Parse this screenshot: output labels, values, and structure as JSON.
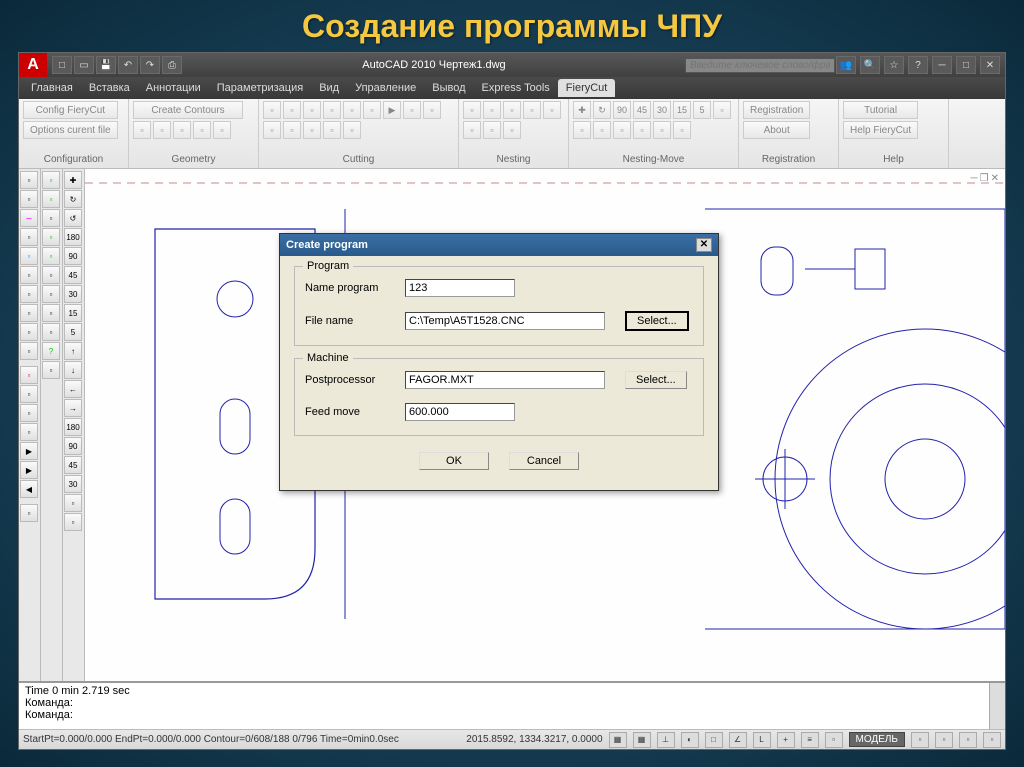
{
  "slide_title": "Создание программы ЧПУ",
  "qat": {
    "app_title": "AutoCAD 2010   Чертеж1.dwg",
    "search_placeholder": "Введите ключевое слово/фразу"
  },
  "menubar": {
    "items": [
      "Главная",
      "Вставка",
      "Аннотации",
      "Параметризация",
      "Вид",
      "Управление",
      "Вывод",
      "Express Tools",
      "FieryCut"
    ],
    "active": 8
  },
  "ribbon": {
    "groups": [
      {
        "label": "Configuration",
        "buttons": [
          "Config FieryCut",
          "Options curent file"
        ]
      },
      {
        "label": "Geometry",
        "buttons": [
          "Create Contours"
        ]
      },
      {
        "label": "Cutting"
      },
      {
        "label": "Nesting"
      },
      {
        "label": "Nesting-Move"
      },
      {
        "label": "Registration",
        "buttons": [
          "Registration",
          "About"
        ]
      },
      {
        "label": "Help",
        "buttons": [
          "Tutorial",
          "Help FieryCut"
        ]
      }
    ]
  },
  "dialog": {
    "title": "Create program",
    "program_group": "Program",
    "machine_group": "Machine",
    "name_label": "Name program",
    "name_value": "123",
    "file_label": "File name",
    "file_value": "C:\\Temp\\A5T1528.CNC",
    "select_btn": "Select...",
    "post_label": "Postprocessor",
    "post_value": "FAGOR.MXT",
    "feed_label": "Feed move",
    "feed_value": "600.000",
    "ok": "OK",
    "cancel": "Cancel"
  },
  "cmdline": {
    "line1": "Time  0 min 2.719 sec",
    "line2": "Команда:",
    "line3": "Команда:"
  },
  "statusbar": {
    "left": "StartPt=0.000/0.000  EndPt=0.000/0.000  Contour=0/608/188  0/796  Time=0min0.0sec",
    "coords": "2015.8592, 1334.3217, 0.0000",
    "model": "МОДЕЛЬ"
  }
}
